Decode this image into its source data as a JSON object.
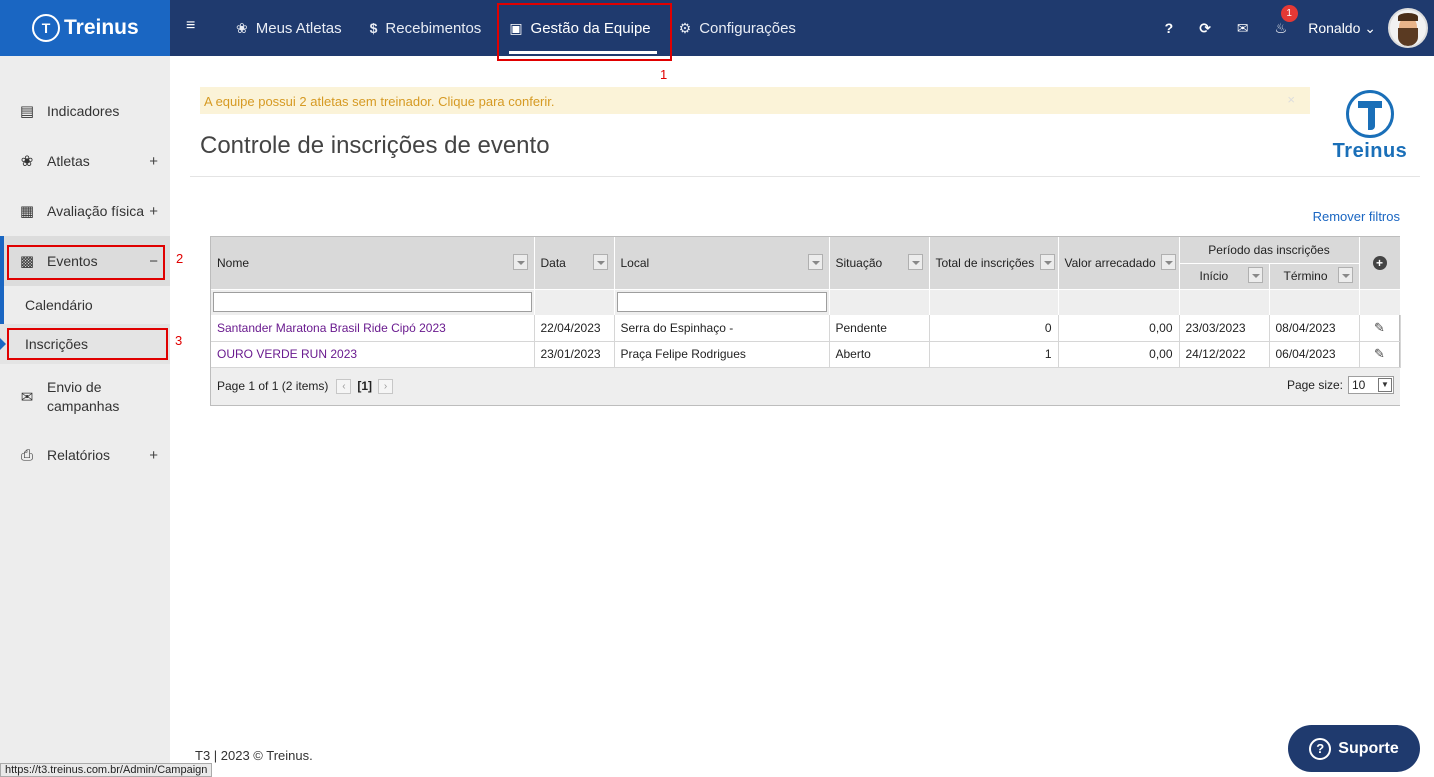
{
  "brand": {
    "name": "Treinus"
  },
  "nav": {
    "items": [
      {
        "label": "Meus Atletas",
        "icon": "medal-icon"
      },
      {
        "label": "Recebimentos",
        "icon": "dollar-icon"
      },
      {
        "label": "Gestão da Equipe",
        "icon": "team-icon",
        "active": true
      },
      {
        "label": "Configurações",
        "icon": "gears-icon"
      }
    ]
  },
  "topright": {
    "help": "?",
    "notification_count": "1",
    "user_name": "Ronaldo"
  },
  "sidebar": {
    "items": [
      {
        "label": "Indicadores",
        "icon": "chart-icon"
      },
      {
        "label": "Atletas",
        "icon": "medal-icon",
        "expand": "+"
      },
      {
        "label": "Avaliação física",
        "icon": "ruler-icon",
        "expand": "+"
      },
      {
        "label": "Eventos",
        "icon": "calendar-icon",
        "expand": "−"
      },
      {
        "label": "Envio de campanhas",
        "icon": "envelope-icon"
      },
      {
        "label": "Relatórios",
        "icon": "printer-icon",
        "expand": "+"
      }
    ],
    "sub_items": [
      {
        "label": "Calendário"
      },
      {
        "label": "Inscrições",
        "active": true
      }
    ]
  },
  "annotations": [
    "1",
    "2",
    "3"
  ],
  "alert": {
    "text": "A equipe possui 2 atletas sem treinador. Clique para conferir.",
    "close": "×"
  },
  "page": {
    "title": "Controle de inscrições de evento",
    "remove_filters": "Remover filtros"
  },
  "grid": {
    "columns": {
      "nome": "Nome",
      "data": "Data",
      "local": "Local",
      "situacao": "Situação",
      "total": "Total de inscrições",
      "valor": "Valor arrecadado",
      "periodo": "Período das inscrições",
      "inicio": "Início",
      "termino": "Término"
    },
    "rows": [
      {
        "nome": "Santander Maratona Brasil Ride Cipó 2023",
        "data": "22/04/2023",
        "local": "Serra do Espinhaço -",
        "situacao": "Pendente",
        "total": "0",
        "valor": "0,00",
        "inicio": "23/03/2023",
        "termino": "08/04/2023"
      },
      {
        "nome": "OURO VERDE RUN 2023",
        "data": "23/01/2023",
        "local": "Praça Felipe Rodrigues",
        "situacao": "Aberto",
        "total": "1",
        "valor": "0,00",
        "inicio": "24/12/2022",
        "termino": "06/04/2023"
      }
    ],
    "pager": {
      "summary": "Page 1 of 1 (2 items)",
      "current": "[1]",
      "page_size_label": "Page size:",
      "page_size": "10"
    }
  },
  "footer": {
    "text": "T3 | 2023 © Treinus."
  },
  "statusbar": {
    "url": "https://t3.treinus.com.br/Admin/Campaign"
  },
  "support": {
    "label": "Suporte"
  },
  "colors": {
    "topbar": "#1f3a6e",
    "brand": "#1a66c2",
    "alert_bg": "#fbf3d8",
    "alert_text": "#d69a23",
    "link": "#6a1b8f",
    "annotation": "#e00000"
  }
}
